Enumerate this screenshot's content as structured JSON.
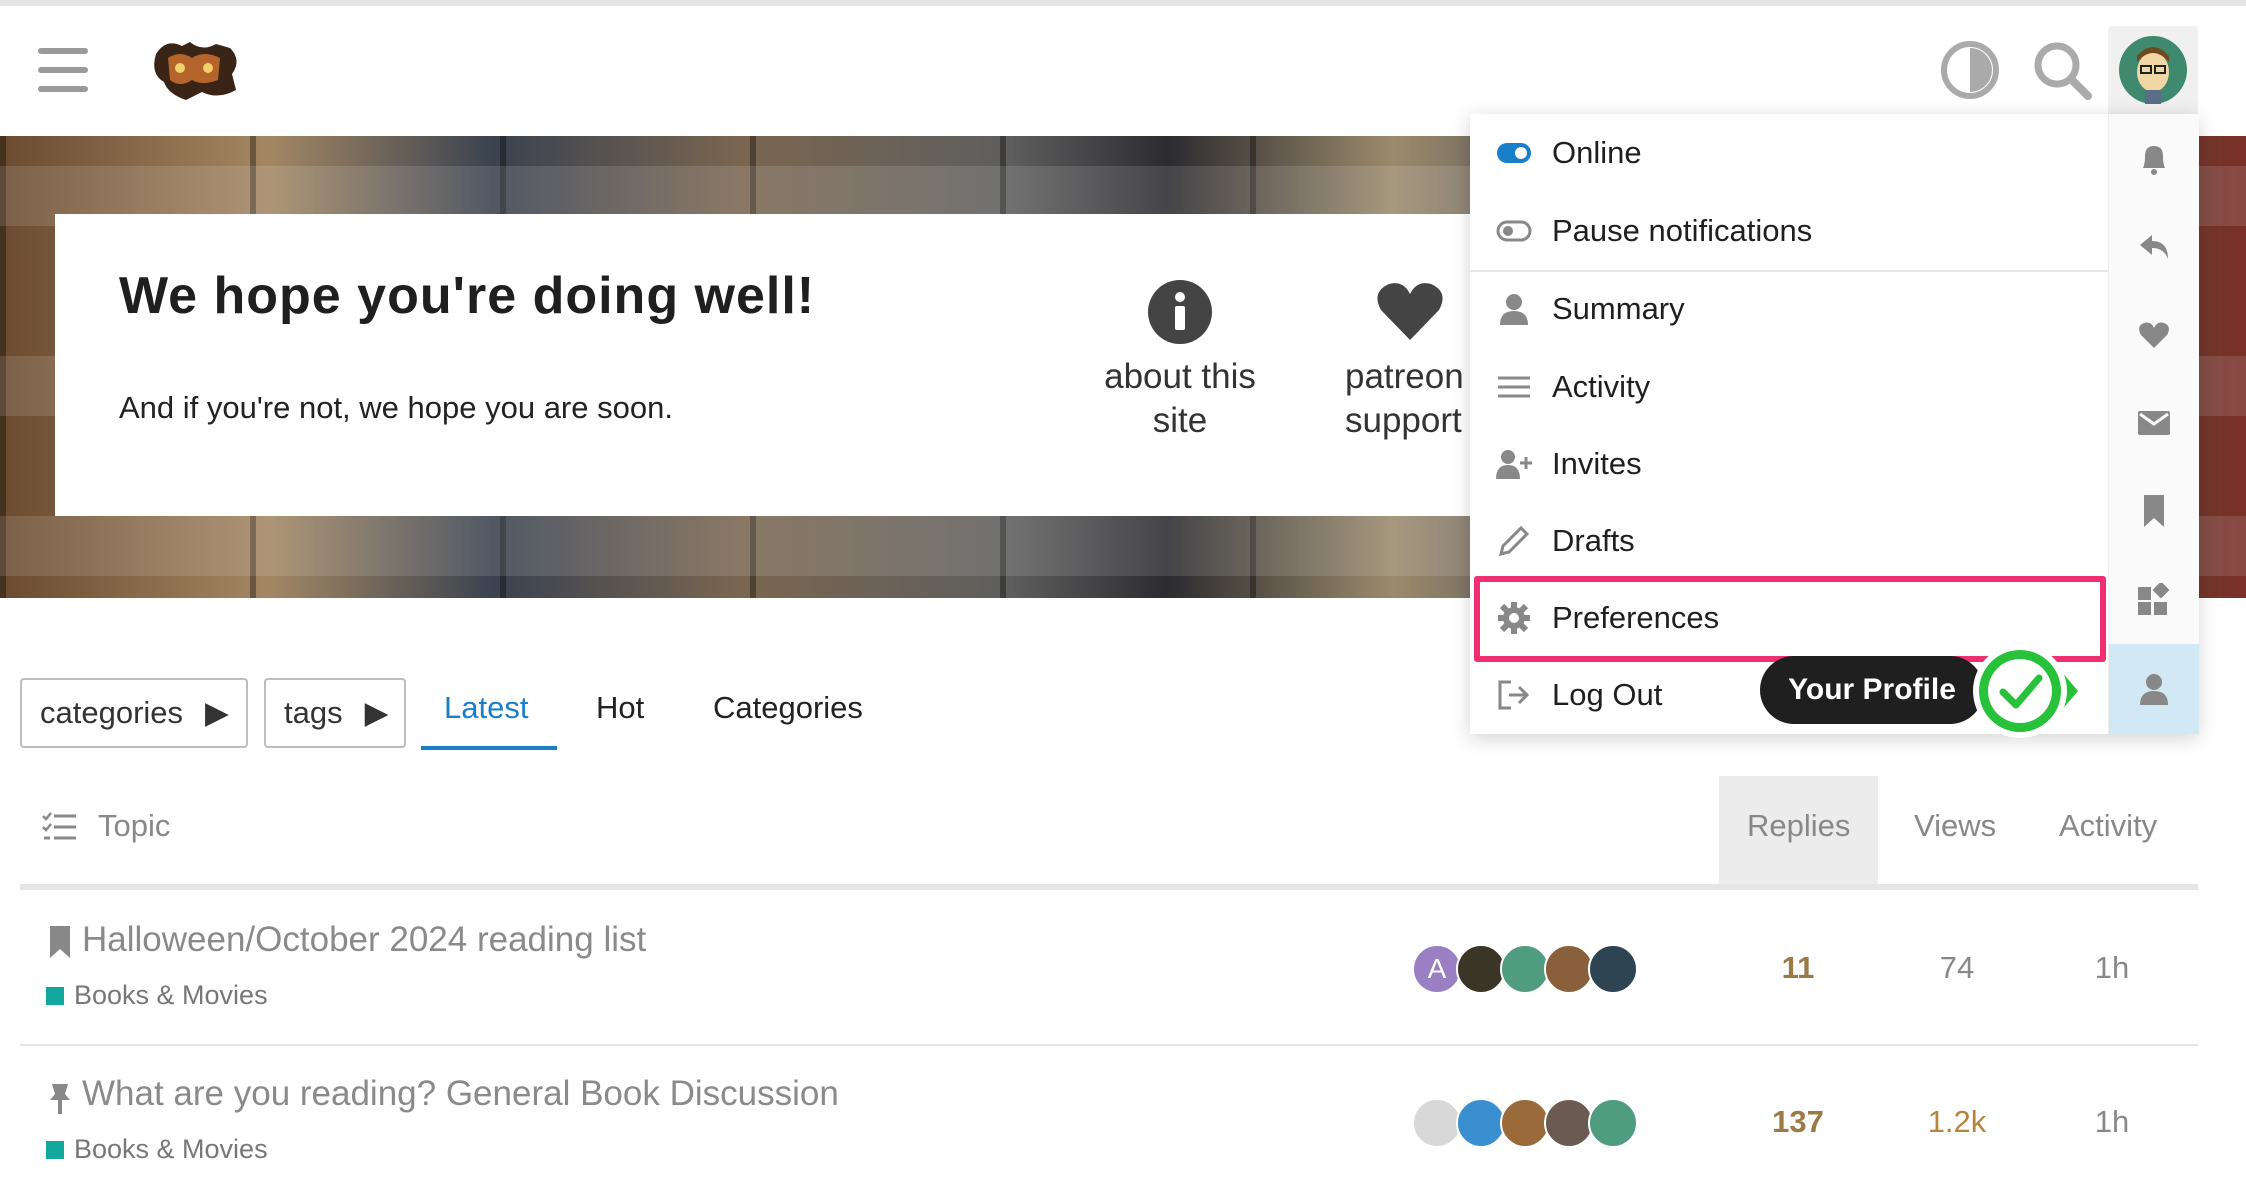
{
  "header": {
    "logo_alt": "The Dungeon Dive",
    "icons": [
      "hamburger-menu-icon",
      "theme-toggle-icon",
      "search-icon",
      "user-avatar"
    ]
  },
  "welcome": {
    "title": "We hope you're doing well!",
    "subtitle": "And if you're not, we hope you are soon.",
    "links": [
      {
        "label_line1": "about this",
        "label_line2": "site",
        "icon": "info-icon"
      },
      {
        "label_line1": "patreon",
        "label_line2": "support",
        "icon": "heart-icon"
      }
    ]
  },
  "nav": {
    "filters": [
      {
        "label": "categories"
      },
      {
        "label": "tags"
      }
    ],
    "tabs": [
      {
        "label": "Latest",
        "active": true
      },
      {
        "label": "Hot"
      },
      {
        "label": "Categories"
      }
    ]
  },
  "table": {
    "headers": {
      "topic": "Topic",
      "replies": "Replies",
      "views": "Views",
      "activity": "Activity"
    },
    "rows": [
      {
        "title": "Halloween/October 2024 reading list",
        "category": "Books & Movies",
        "replies": "11",
        "views": "74",
        "activity": "1h",
        "icon": "bookmark-icon"
      },
      {
        "title": "What are you reading? General Book Discussion",
        "category": "Books & Movies",
        "replies": "137",
        "views": "1.2k",
        "activity": "1h",
        "icon": "pin-icon"
      }
    ]
  },
  "user_menu": {
    "items": [
      {
        "label": "Online",
        "icon": "toggle-on-icon"
      },
      {
        "label": "Pause notifications",
        "icon": "toggle-off-icon"
      },
      {
        "label": "Summary",
        "icon": "user-icon"
      },
      {
        "label": "Activity",
        "icon": "list-icon"
      },
      {
        "label": "Invites",
        "icon": "user-plus-icon"
      },
      {
        "label": "Drafts",
        "icon": "pencil-icon"
      },
      {
        "label": "Preferences",
        "icon": "gear-icon"
      },
      {
        "label": "Log Out",
        "icon": "sign-out-icon"
      }
    ],
    "side_tabs": [
      "bell-icon",
      "reply-icon",
      "heart-icon",
      "envelope-icon",
      "bookmark-icon",
      "widgets-icon",
      "user-icon"
    ],
    "tooltip": "Your Profile"
  },
  "colors": {
    "accent": "#1a7fcb",
    "highlight": "#ee2f72",
    "category": "#12a89d",
    "replies_hot": "#9c7a45",
    "check": "#27c13a"
  }
}
